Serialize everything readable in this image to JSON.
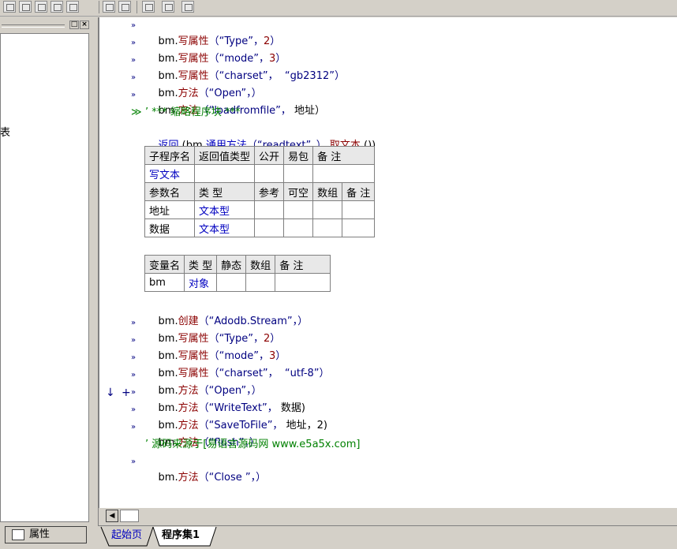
{
  "toolbar": {
    "icons": [
      "grid-icon",
      "table-icon",
      "chart-icon",
      "columns-icon",
      "hspace-icon",
      "vspace-icon",
      "hwidth-icon",
      "vheight-icon",
      "center-icon"
    ]
  },
  "left_panel": {
    "title_buttons": [
      "□",
      "×"
    ],
    "fragment": "表",
    "tab_label": "属性"
  },
  "code_lines_top": [
    {
      "obj": "bm.",
      "meth": "写属性",
      "args": "（“Type”，",
      "num": "2",
      "end": "）"
    },
    {
      "obj": "bm.",
      "meth": "写属性",
      "args": "（“mode”，",
      "num": "3",
      "end": "）"
    },
    {
      "obj": "bm.",
      "meth": "写属性",
      "args": "（“charset”，  “gb2312”）",
      "num": "",
      "end": ""
    },
    {
      "obj": "bm.",
      "meth": "方法",
      "args": "（“Open”，）",
      "num": "",
      "end": ""
    },
    {
      "obj": "bm.",
      "meth": "方法",
      "args": "（“loadfromfile”，",
      "num": "",
      "end": " 地址）"
    }
  ],
  "comment_block": "’ *** 缩略程序块 ***",
  "return_line": {
    "kw": "返回",
    "pre": " (bm.",
    "meth": "通用方法",
    "args": "（“readtext”，）.",
    "meth2": "取文本",
    "end": " ())"
  },
  "sub_table": {
    "headers": [
      "子程序名",
      "返回值类型",
      "公开",
      "易包",
      "备 注"
    ],
    "name": "写文本",
    "param_headers": [
      "参数名",
      "类 型",
      "参考",
      "可空",
      "数组",
      "备 注"
    ],
    "params": [
      {
        "name": "地址",
        "type": "文本型"
      },
      {
        "name": "数据",
        "type": "文本型"
      }
    ]
  },
  "var_table": {
    "headers": [
      "变量名",
      "类 型",
      "静态",
      "数组",
      "备 注"
    ],
    "vars": [
      {
        "name": "bm",
        "type": "对象"
      }
    ]
  },
  "code_lines_bottom": [
    {
      "obj": "bm.",
      "meth": "创建",
      "args": "（“Adodb.Stream”，）",
      "marker": ""
    },
    {
      "obj": "bm.",
      "meth": "写属性",
      "args": "（“Type”，",
      "num": "2",
      "end": "）",
      "marker": "»"
    },
    {
      "obj": "bm.",
      "meth": "写属性",
      "args": "（“mode”，",
      "num": "3",
      "end": "）",
      "marker": "»"
    },
    {
      "obj": "bm.",
      "meth": "写属性",
      "args": "（“charset”，  “utf-8”）",
      "marker": "»"
    },
    {
      "obj": "bm.",
      "meth": "方法",
      "args": "（“Open”，）",
      "marker": "»"
    },
    {
      "obj": "bm.",
      "meth": "方法",
      "args": "（“WriteText”，",
      "end": " 数据)",
      "marker": "»"
    },
    {
      "obj": "bm.",
      "meth": "方法",
      "args": "（“SaveToFile”，",
      "end": " 地址，2)",
      "marker": "»"
    },
    {
      "obj": "bm.",
      "meth": "方法",
      "args": "（“flush”，）",
      "marker": "»"
    }
  ],
  "comment_line": "’ 源码来源于[易语言源码网 www.e5a5x.com]",
  "last_line": {
    "obj": "bm.",
    "meth": "方法",
    "args": "（“Close ”，）"
  },
  "debug_markers": {
    "arrow": "↓",
    "plus": "+"
  },
  "tabs": [
    "起始页",
    "程序集1"
  ]
}
